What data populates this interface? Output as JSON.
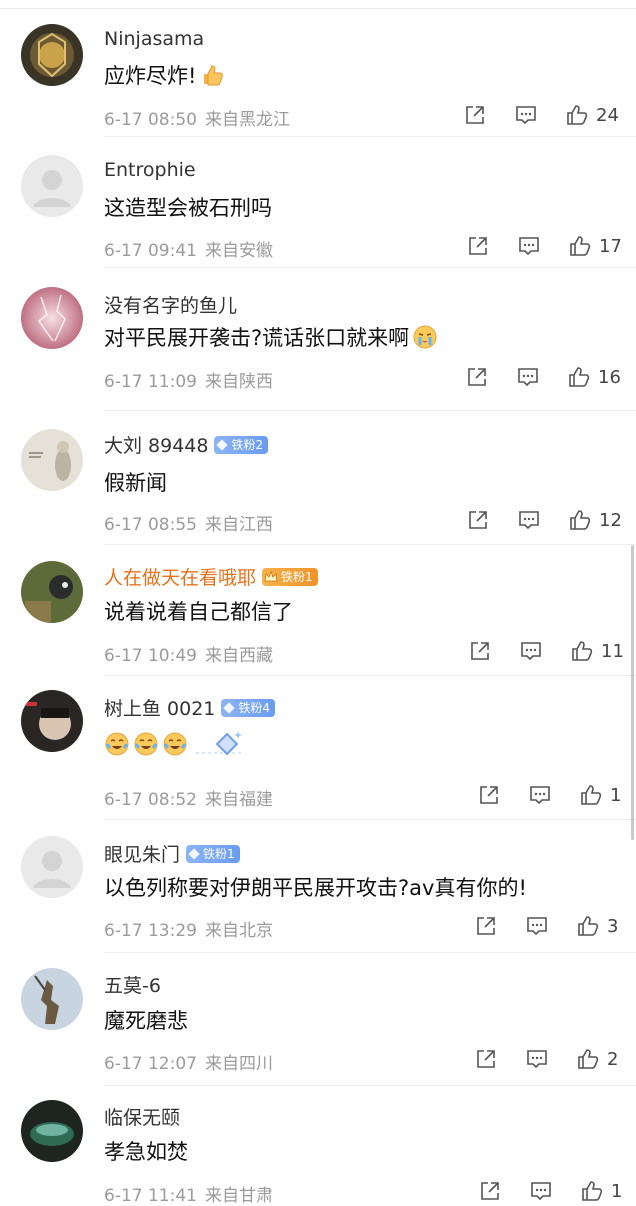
{
  "comments": [
    {
      "username": "Ninjasama",
      "badge": "",
      "badge_style": "",
      "text": "应炸尽炸!",
      "emoji": "thumbs-up-emoji",
      "time": "6-17 08:50",
      "location": "来自黑龙江",
      "likes": "24"
    },
    {
      "username": "Entrophie",
      "badge": "",
      "badge_style": "",
      "text": "这造型会被石刑吗",
      "emoji": "",
      "time": "6-17 09:41",
      "location": "来自安徽",
      "likes": "17"
    },
    {
      "username": "没有名字的鱼儿",
      "badge": "",
      "badge_style": "",
      "text": "对平民展开袭击?谎话张口就来啊",
      "emoji": "crying-emoji",
      "time": "6-17 11:09",
      "location": "来自陕西",
      "likes": "16"
    },
    {
      "username": "大刘 89448",
      "badge": "铁粉2",
      "badge_style": "blue",
      "text": "假新闻",
      "emoji": "",
      "time": "6-17 08:55",
      "location": "来自江西",
      "likes": "12"
    },
    {
      "username": "人在做天在看哦耶",
      "badge": "铁粉1",
      "badge_style": "gold",
      "text": "说着说着自己都信了",
      "emoji": "",
      "time": "6-17 10:49",
      "location": "来自西藏",
      "likes": "11"
    },
    {
      "username": "树上鱼 0021",
      "badge": "铁粉4",
      "badge_style": "blue",
      "text": "",
      "emoji": "tears-of-joy-emoji-x3",
      "time": "6-17 08:52",
      "location": "来自福建",
      "likes": "1"
    },
    {
      "username": "眼见朱门",
      "badge": "铁粉1",
      "badge_style": "blue",
      "text": "以色列称要对伊朗平民展开攻击?av真有你的!",
      "emoji": "",
      "time": "6-17 13:29",
      "location": "来自北京",
      "likes": "3"
    },
    {
      "username": "五莫-6",
      "badge": "",
      "badge_style": "",
      "text": "魔死磨悲",
      "emoji": "",
      "time": "6-17 12:07",
      "location": "来自四川",
      "likes": "2"
    },
    {
      "username": "临保无颐",
      "badge": "",
      "badge_style": "",
      "text": "孝急如焚",
      "emoji": "",
      "time": "6-17 11:41",
      "location": "来自甘肃",
      "likes": "1"
    }
  ],
  "colors": {
    "vip_name": "#e8711a",
    "badge_blue": "#7aa8f4",
    "badge_gold": "#f2a038",
    "meta": "#9b9b9b"
  }
}
